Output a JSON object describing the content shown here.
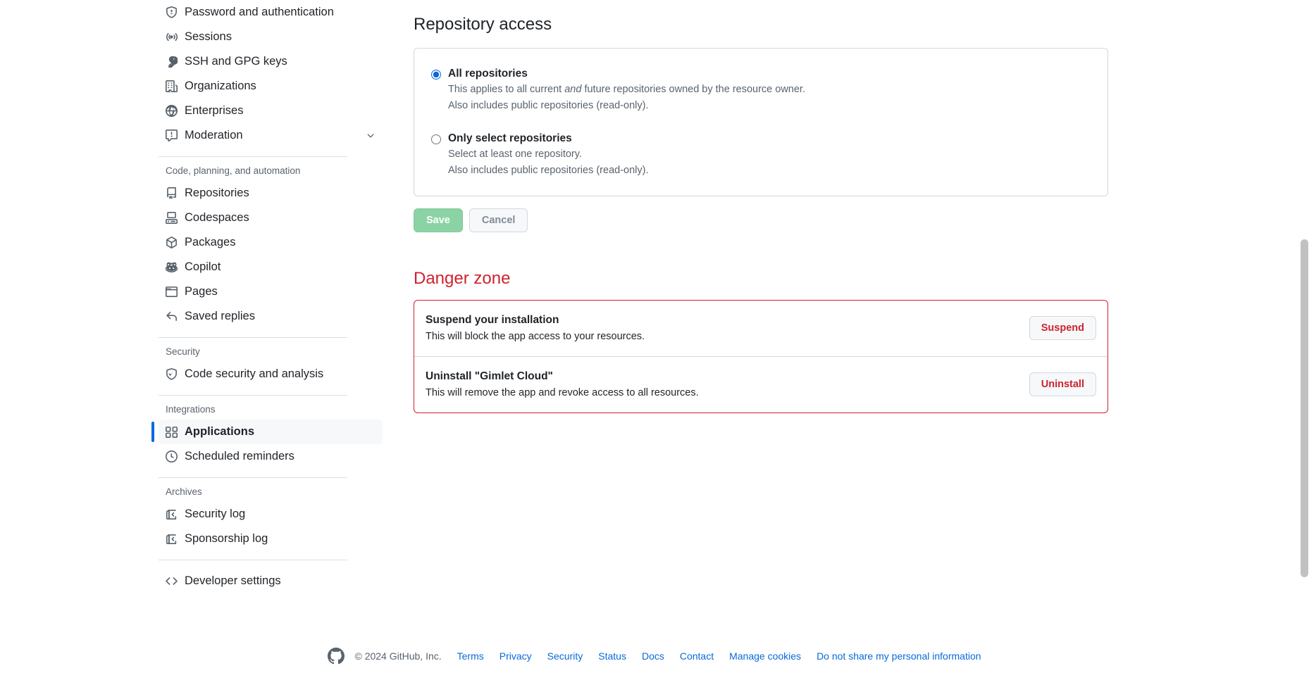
{
  "sidebar": {
    "groups": [
      {
        "title": null,
        "items": [
          {
            "label": "Password and authentication",
            "icon": "shield-lock-icon",
            "selected": false
          },
          {
            "label": "Sessions",
            "icon": "broadcast-icon",
            "selected": false
          },
          {
            "label": "SSH and GPG keys",
            "icon": "key-icon",
            "selected": false
          },
          {
            "label": "Organizations",
            "icon": "organization-icon",
            "selected": false
          },
          {
            "label": "Enterprises",
            "icon": "globe-icon",
            "selected": false
          },
          {
            "label": "Moderation",
            "icon": "report-icon",
            "selected": false,
            "chevron": true
          }
        ]
      },
      {
        "title": "Code, planning, and automation",
        "items": [
          {
            "label": "Repositories",
            "icon": "repo-icon",
            "selected": false
          },
          {
            "label": "Codespaces",
            "icon": "codespaces-icon",
            "selected": false
          },
          {
            "label": "Packages",
            "icon": "package-icon",
            "selected": false
          },
          {
            "label": "Copilot",
            "icon": "copilot-icon",
            "selected": false
          },
          {
            "label": "Pages",
            "icon": "browser-icon",
            "selected": false
          },
          {
            "label": "Saved replies",
            "icon": "reply-icon",
            "selected": false
          }
        ]
      },
      {
        "title": "Security",
        "items": [
          {
            "label": "Code security and analysis",
            "icon": "shield-check-icon",
            "selected": false
          }
        ]
      },
      {
        "title": "Integrations",
        "items": [
          {
            "label": "Applications",
            "icon": "apps-icon",
            "selected": true
          },
          {
            "label": "Scheduled reminders",
            "icon": "clock-icon",
            "selected": false
          }
        ]
      },
      {
        "title": "Archives",
        "items": [
          {
            "label": "Security log",
            "icon": "log-icon",
            "selected": false
          },
          {
            "label": "Sponsorship log",
            "icon": "log-icon",
            "selected": false
          }
        ]
      },
      {
        "title": null,
        "items": [
          {
            "label": "Developer settings",
            "icon": "code-icon",
            "selected": false
          }
        ]
      }
    ]
  },
  "main": {
    "repository_access": {
      "heading": "Repository access",
      "options": [
        {
          "label": "All repositories",
          "selected": true,
          "desc_line1_before": "This applies to all current ",
          "desc_line1_em": "and",
          "desc_line1_after": " future repositories owned by the resource owner.",
          "desc_line2": "Also includes public repositories (read-only)."
        },
        {
          "label": "Only select repositories",
          "selected": false,
          "desc_line1": "Select at least one repository.",
          "desc_line2": "Also includes public repositories (read-only)."
        }
      ],
      "save_label": "Save",
      "cancel_label": "Cancel"
    },
    "danger_zone": {
      "heading": "Danger zone",
      "rows": [
        {
          "title": "Suspend your installation",
          "description": "This will block the app access to your resources.",
          "button": "Suspend"
        },
        {
          "title": "Uninstall \"Gimlet Cloud\"",
          "description": "This will remove the app and revoke access to all resources.",
          "button": "Uninstall"
        }
      ]
    }
  },
  "footer": {
    "copyright": "© 2024 GitHub, Inc.",
    "links": [
      "Terms",
      "Privacy",
      "Security",
      "Status",
      "Docs",
      "Contact",
      "Manage cookies",
      "Do not share my personal information"
    ]
  },
  "colors": {
    "accent": "#0969da",
    "danger": "#cf222e",
    "success_muted": "#8bd3a4",
    "muted_text": "#59636e"
  }
}
